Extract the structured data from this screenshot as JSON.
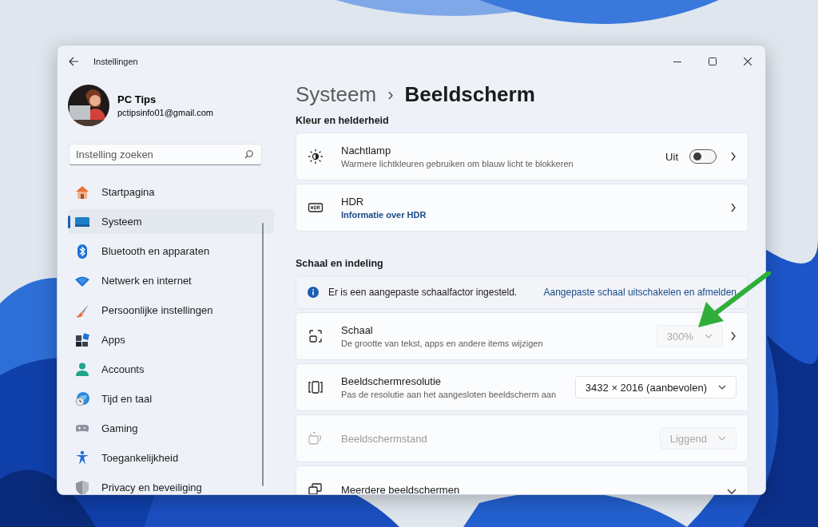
{
  "window": {
    "title": "Instellingen"
  },
  "account": {
    "name": "PC Tips",
    "email": "pctipsinfo01@gmail.com"
  },
  "search": {
    "placeholder": "Instelling zoeken"
  },
  "nav": [
    {
      "label": "Startpagina",
      "selected": false
    },
    {
      "label": "Systeem",
      "selected": true
    },
    {
      "label": "Bluetooth en apparaten",
      "selected": false
    },
    {
      "label": "Netwerk en internet",
      "selected": false
    },
    {
      "label": "Persoonlijke instellingen",
      "selected": false
    },
    {
      "label": "Apps",
      "selected": false
    },
    {
      "label": "Accounts",
      "selected": false
    },
    {
      "label": "Tijd en taal",
      "selected": false
    },
    {
      "label": "Gaming",
      "selected": false
    },
    {
      "label": "Toegankelijkheid",
      "selected": false
    },
    {
      "label": "Privacy en beveiliging",
      "selected": false
    }
  ],
  "breadcrumb": {
    "parent": "Systeem",
    "separator": "›",
    "current": "Beeldscherm"
  },
  "sections": [
    {
      "heading": "Kleur en helderheid",
      "items": [
        {
          "kind": "setting",
          "title": "Nachtlamp",
          "subtitle": "Warmere lichtkleuren gebruiken om blauw licht te blokkeren",
          "disabled": false,
          "control": {
            "kind": "toggle",
            "label": "Uit",
            "on": false
          },
          "opens_page": true
        },
        {
          "kind": "setting",
          "title": "HDR",
          "link": "Informatie over HDR",
          "disabled": false,
          "opens_page": true
        }
      ]
    },
    {
      "heading": "Schaal en indeling",
      "items": [
        {
          "kind": "info",
          "text": "Er is een aangepaste schaalfactor ingesteld.",
          "link": "Aangepaste schaal uitschakelen en afmelden"
        },
        {
          "kind": "setting",
          "title": "Schaal",
          "subtitle": "De grootte van tekst, apps en andere items wijzigen",
          "disabled": false,
          "control": {
            "kind": "dropdown",
            "value": "300%",
            "disabled": true
          },
          "opens_page": true
        },
        {
          "kind": "setting",
          "title": "Beeldschermresolutie",
          "subtitle": "Pas de resolutie aan het aangesloten beeldscherm aan",
          "disabled": false,
          "control": {
            "kind": "dropdown",
            "value": "3432 × 2016 (aanbevolen)",
            "disabled": false
          }
        },
        {
          "kind": "setting",
          "title": "Beeldschermstand",
          "disabled": true,
          "control": {
            "kind": "dropdown",
            "value": "Liggend",
            "disabled": true
          }
        },
        {
          "kind": "setting",
          "title": "Meerdere beeldschermen",
          "disabled": false,
          "expandable": true
        }
      ]
    }
  ]
}
